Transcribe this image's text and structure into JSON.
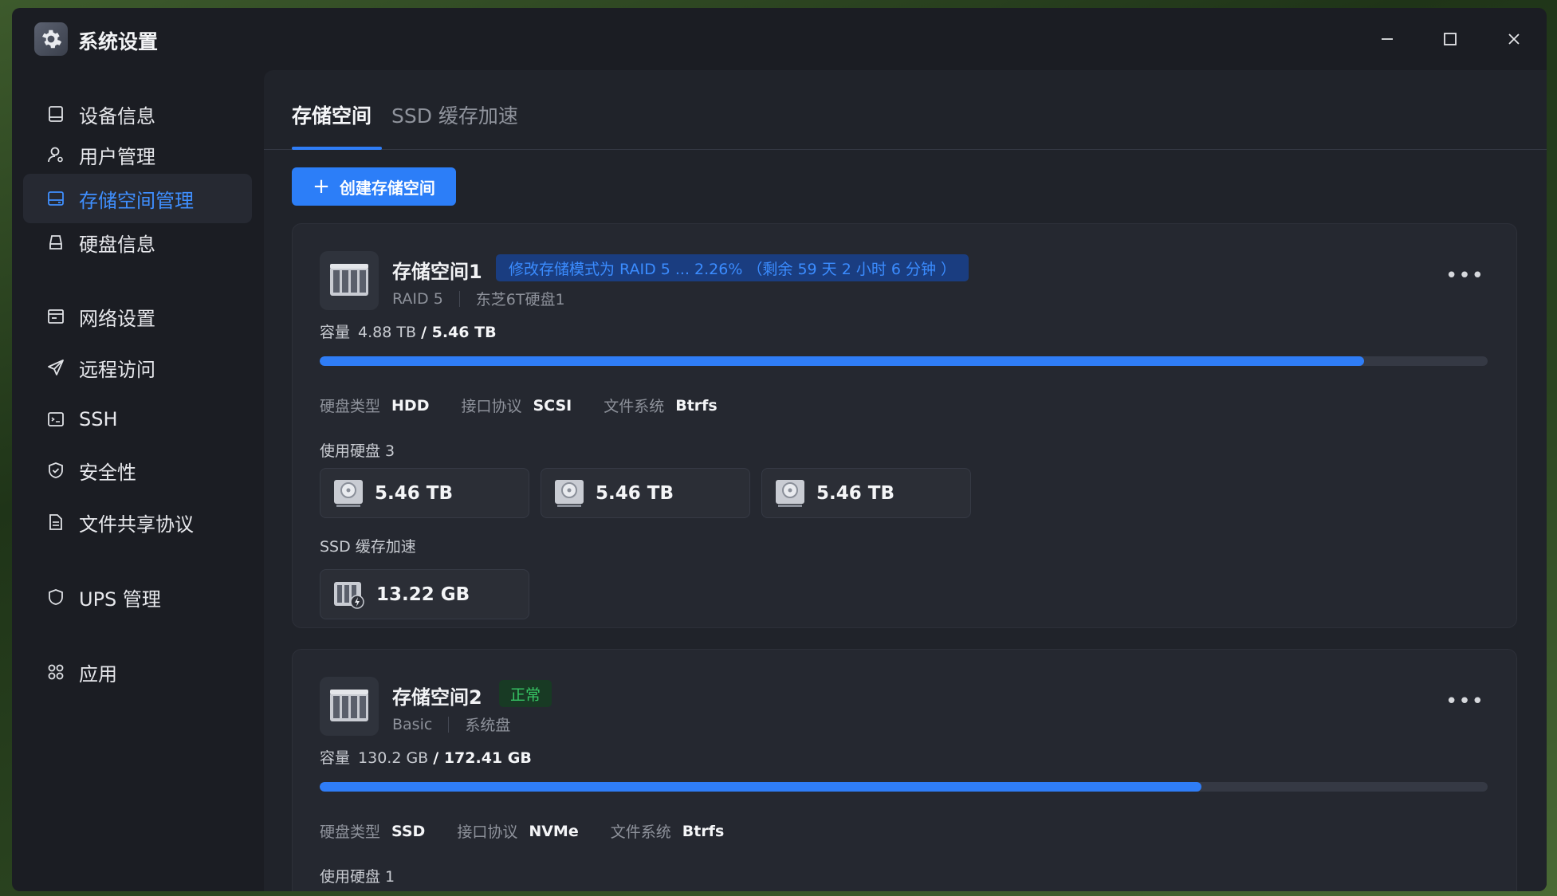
{
  "window": {
    "title": "系统设置",
    "app_icon": "gear-icon",
    "controls": [
      "minimize-icon",
      "maximize-icon",
      "close-icon"
    ]
  },
  "sidebar": {
    "items": [
      {
        "label": "设备信息",
        "icon": "device-icon"
      },
      {
        "label": "用户管理",
        "icon": "user-icon"
      },
      {
        "label": "存储空间管理",
        "icon": "storage-icon",
        "active": true
      },
      {
        "label": "硬盘信息",
        "icon": "disk-icon"
      },
      {
        "label": "网络设置",
        "icon": "network-icon"
      },
      {
        "label": "远程访问",
        "icon": "send-icon"
      },
      {
        "label": "SSH",
        "icon": "terminal-icon"
      },
      {
        "label": "安全性",
        "icon": "shield-check-icon"
      },
      {
        "label": "文件共享协议",
        "icon": "document-icon"
      },
      {
        "label": "UPS 管理",
        "icon": "shield-icon"
      },
      {
        "label": "应用",
        "icon": "apps-icon"
      }
    ]
  },
  "tabs": [
    {
      "label": "存储空间",
      "active": true
    },
    {
      "label": "SSD 缓存加速",
      "active": false
    }
  ],
  "toolbar": {
    "create_label": "创建存储空间",
    "create_icon": "plus-icon"
  },
  "pools": [
    {
      "name": "存储空间1",
      "status": "修改存储模式为 RAID 5 ... 2.26% （剩余 59 天 2 小时 6 分钟 ）",
      "status_color": "#3b8cff",
      "raid": "RAID 5",
      "description": "东芝6T硬盘1",
      "capacity_label": "容量",
      "used": "4.88 TB",
      "total": "/ 5.46 TB",
      "usage_fraction": 0.894,
      "props": [
        {
          "label": "硬盘类型",
          "value": "HDD"
        },
        {
          "label": "接口协议",
          "value": "SCSI"
        },
        {
          "label": "文件系统",
          "value": "Btrfs"
        }
      ],
      "disks_label": "使用硬盘 3",
      "disks": [
        "5.46 TB",
        "5.46 TB",
        "5.46 TB"
      ],
      "ssd_label": "SSD 缓存加速",
      "ssd": [
        "13.22 GB"
      ]
    },
    {
      "name": "存储空间2",
      "status": "正常",
      "status_color": "#37c765",
      "raid": "Basic",
      "description": "系统盘",
      "capacity_label": "容量",
      "used": "130.2 GB",
      "total": "/ 172.41 GB",
      "usage_fraction": 0.755,
      "props": [
        {
          "label": "硬盘类型",
          "value": "SSD"
        },
        {
          "label": "接口协议",
          "value": "NVMe"
        },
        {
          "label": "文件系统",
          "value": "Btrfs"
        }
      ],
      "disks_label": "使用硬盘 1"
    }
  ],
  "colors": {
    "accent": "#2f7df6",
    "active_nav": "#3f8fff",
    "background": "#1b1d23"
  }
}
